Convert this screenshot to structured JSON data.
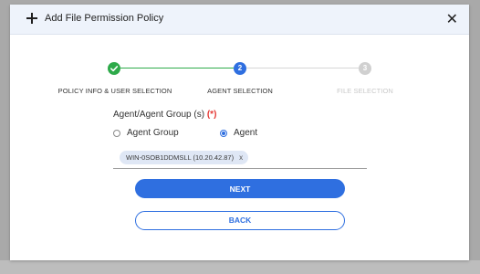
{
  "dialog": {
    "title": "Add File Permission Policy"
  },
  "stepper": {
    "steps": [
      {
        "label": "POLICY INFO & USER SELECTION",
        "number": "",
        "state": "completed"
      },
      {
        "label": "AGENT SELECTION",
        "number": "2",
        "state": "active"
      },
      {
        "label": "FILE SELECTION",
        "number": "3",
        "state": "pending"
      }
    ]
  },
  "form": {
    "field_label": "Agent/Agent Group (s)",
    "required_marker": "(*)",
    "options": [
      {
        "label": "Agent Group",
        "checked": false
      },
      {
        "label": "Agent",
        "checked": true
      }
    ],
    "selected_chips": [
      {
        "label": "WIN-0SOB1DDMSLL (10.20.42.87)",
        "remove": "x"
      }
    ]
  },
  "actions": {
    "next_label": "NEXT",
    "back_label": "BACK"
  },
  "colors": {
    "accent": "#2f6fe0",
    "completed": "#2eaa4a",
    "pending": "#cfcfcf",
    "required": "#e53935"
  }
}
